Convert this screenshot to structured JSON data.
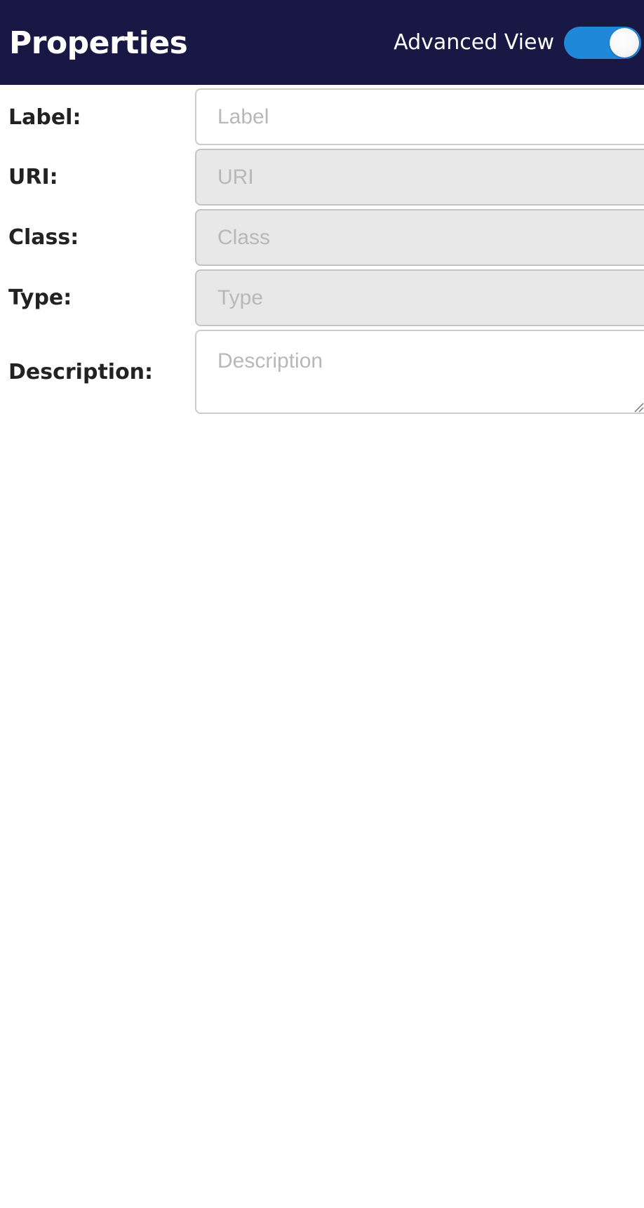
{
  "header": {
    "title": "Properties",
    "advanced_view_label": "Advanced View",
    "advanced_view_enabled": true
  },
  "form": {
    "fields": [
      {
        "label": "Label:",
        "placeholder": "Label",
        "value": "",
        "readonly": false
      },
      {
        "label": "URI:",
        "placeholder": "URI",
        "value": "",
        "readonly": true
      },
      {
        "label": "Class:",
        "placeholder": "Class",
        "value": "",
        "readonly": true
      },
      {
        "label": "Type:",
        "placeholder": "Type",
        "value": "",
        "readonly": true
      },
      {
        "label": "Description:",
        "placeholder": "Description",
        "value": "",
        "readonly": false
      }
    ]
  },
  "colors": {
    "header_background": "#191844",
    "toggle_on": "#1f88d8",
    "readonly_field_background": "#e8e8e8"
  }
}
